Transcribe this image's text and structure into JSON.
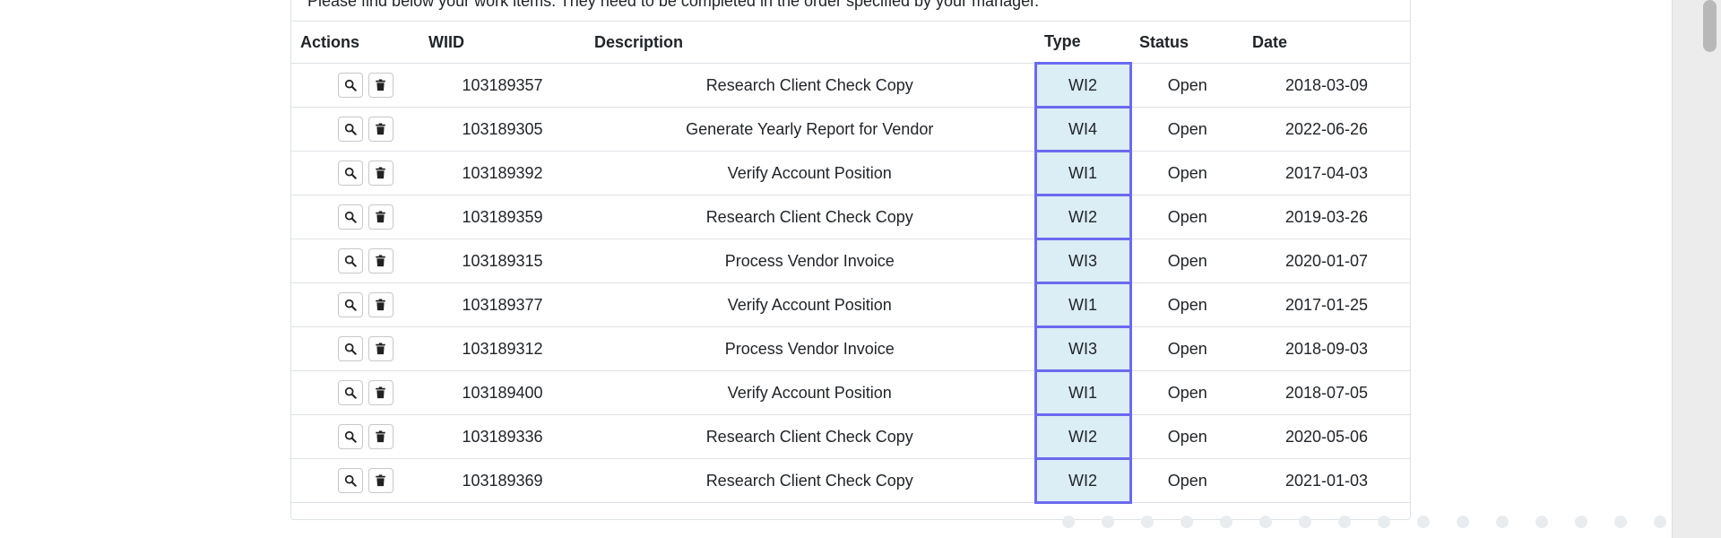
{
  "intro_text": "Please find below your work items. They need to be completed in the order specified by your manager.",
  "table": {
    "headers": {
      "actions": "Actions",
      "wiid": "WIID",
      "description": "Description",
      "type": "Type",
      "status": "Status",
      "date": "Date"
    },
    "rows": [
      {
        "wiid": "103189357",
        "description": "Research Client Check Copy",
        "type": "WI2",
        "status": "Open",
        "date": "2018-03-09"
      },
      {
        "wiid": "103189305",
        "description": "Generate Yearly Report for Vendor",
        "type": "WI4",
        "status": "Open",
        "date": "2022-06-26"
      },
      {
        "wiid": "103189392",
        "description": "Verify Account Position",
        "type": "WI1",
        "status": "Open",
        "date": "2017-04-03"
      },
      {
        "wiid": "103189359",
        "description": "Research Client Check Copy",
        "type": "WI2",
        "status": "Open",
        "date": "2019-03-26"
      },
      {
        "wiid": "103189315",
        "description": "Process Vendor Invoice",
        "type": "WI3",
        "status": "Open",
        "date": "2020-01-07"
      },
      {
        "wiid": "103189377",
        "description": "Verify Account Position",
        "type": "WI1",
        "status": "Open",
        "date": "2017-01-25"
      },
      {
        "wiid": "103189312",
        "description": "Process Vendor Invoice",
        "type": "WI3",
        "status": "Open",
        "date": "2018-09-03"
      },
      {
        "wiid": "103189400",
        "description": "Verify Account Position",
        "type": "WI1",
        "status": "Open",
        "date": "2018-07-05"
      },
      {
        "wiid": "103189336",
        "description": "Research Client Check Copy",
        "type": "WI2",
        "status": "Open",
        "date": "2020-05-06"
      },
      {
        "wiid": "103189369",
        "description": "Research Client Check Copy",
        "type": "WI2",
        "status": "Open",
        "date": "2021-01-03"
      }
    ]
  },
  "icons": {
    "view": "search-icon",
    "delete": "trash-icon"
  },
  "colors": {
    "type_highlight_bg": "#dbedf5",
    "type_highlight_border": "#6a6af0",
    "grid_border": "#dee2e6"
  }
}
